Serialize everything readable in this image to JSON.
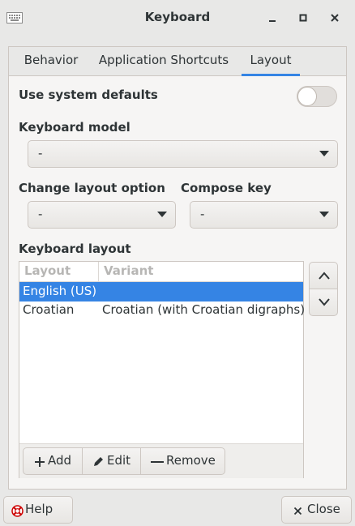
{
  "window": {
    "title": "Keyboard",
    "icon": "keyboard-icon",
    "controls": [
      "minimize-icon",
      "maximize-icon",
      "close-icon"
    ]
  },
  "tabs": [
    {
      "label": "Behavior",
      "active": false
    },
    {
      "label": "Application Shortcuts",
      "active": false
    },
    {
      "label": "Layout",
      "active": true
    }
  ],
  "layout_tab": {
    "use_system_defaults": {
      "label": "Use system defaults",
      "enabled": false
    },
    "keyboard_model": {
      "label": "Keyboard model",
      "value": "-"
    },
    "change_layout_option": {
      "label": "Change layout option",
      "value": "-"
    },
    "compose_key": {
      "label": "Compose key",
      "value": "-"
    },
    "keyboard_layout": {
      "label": "Keyboard layout",
      "columns": [
        "Layout",
        "Variant"
      ],
      "rows": [
        {
          "layout": "English (US)",
          "variant": "",
          "selected": true
        },
        {
          "layout": "Croatian",
          "variant": "Croatian (with Croatian digraphs)",
          "selected": false
        }
      ],
      "buttons": {
        "add": "Add",
        "edit": "Edit",
        "remove": "Remove"
      },
      "move_icons": [
        "chevron-up-icon",
        "chevron-down-icon"
      ]
    }
  },
  "footer": {
    "help": "Help",
    "close": "Close"
  },
  "colors": {
    "accent": "#3584e4",
    "window_bg": "#e8e8e7",
    "panel_bg": "#f6f5f4",
    "border": "#cdc7c2"
  }
}
